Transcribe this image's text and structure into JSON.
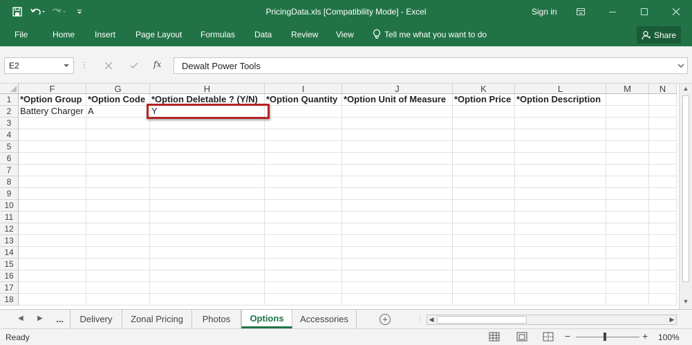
{
  "window": {
    "title": "PricingData.xls  [Compatibility Mode] - Excel",
    "signin_label": "Sign in"
  },
  "ribbon": {
    "tabs": [
      "File",
      "Home",
      "Insert",
      "Page Layout",
      "Formulas",
      "Data",
      "Review",
      "View"
    ],
    "tellme_label": "Tell me what you want to do",
    "share_label": "Share"
  },
  "formula_bar": {
    "name_box": "E2",
    "fx_label": "fx",
    "value": "Dewalt Power Tools"
  },
  "grid": {
    "columns": [
      "F",
      "G",
      "H",
      "I",
      "J",
      "K",
      "L",
      "M",
      "N"
    ],
    "rows": [
      "1",
      "2",
      "3",
      "4",
      "5",
      "6",
      "7",
      "8",
      "9",
      "10",
      "11",
      "12",
      "13",
      "14",
      "15",
      "16",
      "17",
      "18"
    ],
    "header_row": [
      "*Option Group",
      "*Option Code",
      "*Option Deletable ? (Y/N)",
      "*Option Quantity",
      "*Option Unit of Measure",
      "*Option Price",
      "*Option Description",
      "",
      ""
    ],
    "data_row": [
      "Battery Charger",
      "A",
      "Y",
      "",
      "",
      "",
      "",
      "",
      ""
    ]
  },
  "sheet_tabs": {
    "overflow_label": "...",
    "tabs": [
      "Delivery",
      "Zonal Pricing",
      "Photos",
      "Options",
      "Accessories"
    ],
    "active": "Options"
  },
  "status_bar": {
    "status": "Ready",
    "zoom": "100%"
  },
  "colors": {
    "accent": "#217346",
    "highlight_border": "#b42323"
  }
}
